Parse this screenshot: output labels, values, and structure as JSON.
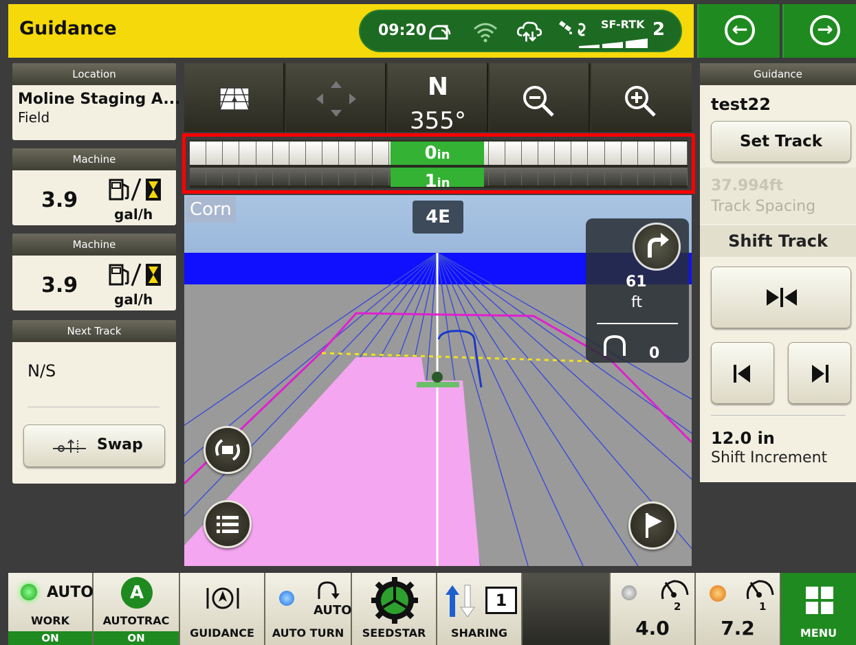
{
  "header": {
    "title": "Guidance",
    "time": "09:20",
    "rtk_label": "SF-RTK",
    "rtk_level": "2",
    "back_icon": "arrow-left-icon",
    "forward_icon": "arrow-right-icon"
  },
  "left_panels": {
    "location": {
      "header": "Location",
      "title": "Moline Staging A...",
      "subtitle": "Field"
    },
    "machine1": {
      "header": "Machine",
      "value": "3.9",
      "unit": "gal/h"
    },
    "machine2": {
      "header": "Machine",
      "value": "3.9",
      "unit": "gal/h"
    },
    "next_track": {
      "header": "Next Track",
      "value": "N/S",
      "swap_label": "Swap"
    }
  },
  "toolbar": {
    "heading_letter": "N",
    "heading_degrees": "355°"
  },
  "lightbar": {
    "top_value": "0",
    "top_unit": "in",
    "bottom_value": "1",
    "bottom_unit": "in"
  },
  "map": {
    "crop": "Corn",
    "track_id": "4E",
    "turn_distance": "61",
    "turn_unit": "ft",
    "turn_count": "0"
  },
  "right_panel": {
    "header": "Guidance",
    "track_name": "test22",
    "set_track_label": "Set Track",
    "track_spacing_value": "37.994ft",
    "track_spacing_label": "Track Spacing",
    "shift_track_label": "Shift Track",
    "shift_increment_value": "12.0 in",
    "shift_increment_label": "Shift Increment"
  },
  "bottom_bar": {
    "work": {
      "top": "AUTO",
      "label": "WORK",
      "state": "ON"
    },
    "autotrac": {
      "letter": "A",
      "label": "AUTOTRAC",
      "state": "ON"
    },
    "guidance_label": "GUIDANCE",
    "autoturn": {
      "top": "AUTO",
      "label": "AUTO TURN"
    },
    "seedstar_label": "SEEDSTAR",
    "sharing": {
      "count": "1",
      "label": "SHARING"
    },
    "speed1": {
      "gear": "2",
      "value": "4.0"
    },
    "speed2": {
      "gear": "1",
      "value": "7.2"
    },
    "menu_label": "MENU"
  },
  "colors": {
    "header_yellow": "#f5d90a",
    "deere_green": "#1f8a1f",
    "lightbar_green": "#34b233",
    "highlight_red": "#ff0000",
    "coverage_pink": "#f4a6f0",
    "boundary_magenta": "#e020d0"
  }
}
